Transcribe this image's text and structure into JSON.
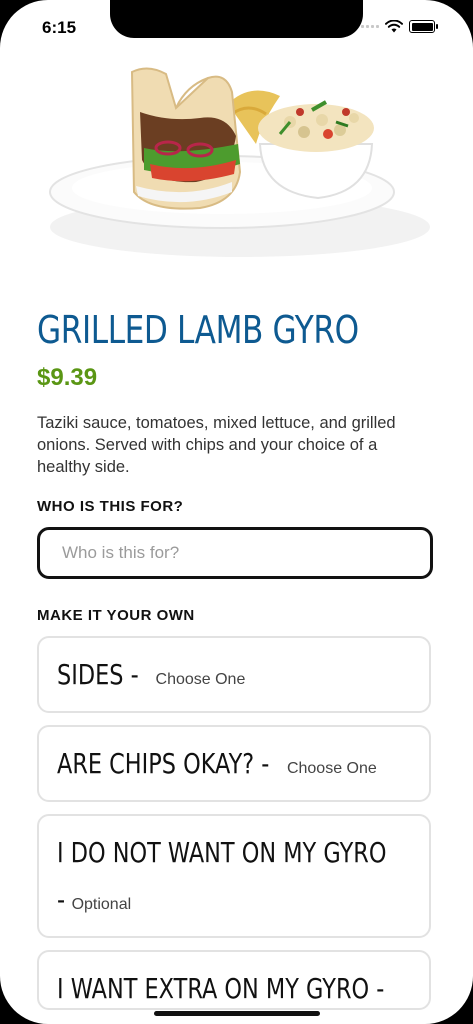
{
  "status": {
    "time": "6:15"
  },
  "item": {
    "title": "GRILLED LAMB GYRO",
    "price": "$9.39",
    "description": "Taziki sauce, tomatoes, mixed lettuce, and grilled onions.  Served with chips and your choice of a healthy side."
  },
  "who_for": {
    "label": "WHO IS THIS FOR?",
    "placeholder": "Who is this for?"
  },
  "customize": {
    "label": "MAKE IT YOUR OWN",
    "options": [
      {
        "title": "SIDES -",
        "sub": "Choose One"
      },
      {
        "title": "ARE CHIPS OKAY? -",
        "sub": "Choose One"
      },
      {
        "title": "I DO NOT WANT ON MY GYRO",
        "sub": "Optional"
      },
      {
        "title": "I WANT EXTRA ON MY GYRO -",
        "sub": ""
      }
    ]
  }
}
